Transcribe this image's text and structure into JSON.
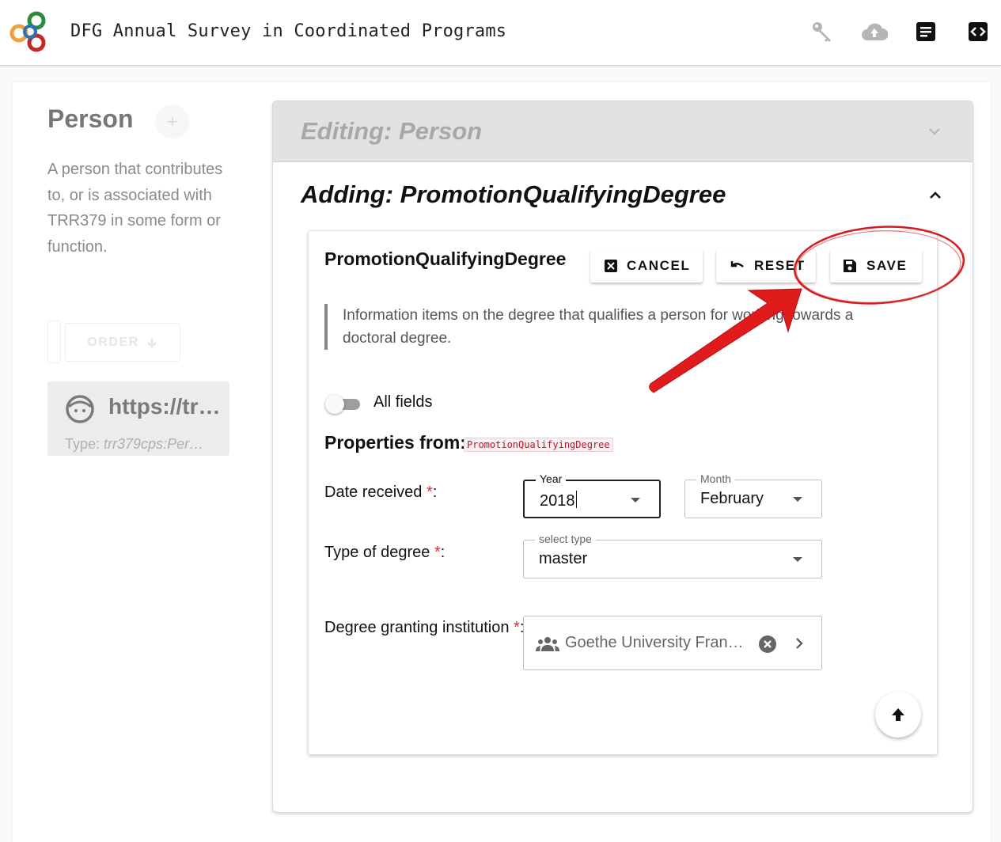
{
  "header": {
    "app_title": "DFG Annual Survey in Coordinated Programs",
    "icons": [
      "key-icon",
      "cloud-upload-icon",
      "document-icon",
      "code-icon"
    ],
    "logo_colors": [
      "#2e8b3c",
      "#f2a13a",
      "#c0282a",
      "#2c6fb7"
    ]
  },
  "sidebar": {
    "title": "Person",
    "add_label": "+",
    "description": "A person that contributes to, or is associated with TRR379 in some form or function.",
    "order_label": "ORDER",
    "item": {
      "title": "https://tr…",
      "type_prefix": "Type: ",
      "type_value": "trr379cps:Per…"
    }
  },
  "editor": {
    "editing_title": "Editing: Person",
    "adding_title": "Adding: PromotionQualifyingDegree"
  },
  "form": {
    "title": "PromotionQualifyingDegree",
    "buttons": {
      "cancel": "CANCEL",
      "reset": "RESET",
      "save": "SAVE"
    },
    "description": "Information items on the degree that qualifies a person for working towards a doctoral degree.",
    "all_fields_label": "All fields",
    "all_fields_on": false,
    "properties_from_label": "Properties from:",
    "properties_from_chip": "PromotionQualifyingDegree",
    "required_marker": "*",
    "date_received": {
      "label": "Date received ",
      "suffix": ":",
      "year_label": "Year",
      "year_value": "2018",
      "month_label": "Month",
      "month_value": "February"
    },
    "type_of_degree": {
      "label": "Type of degree ",
      "suffix": ":",
      "select_label": "select type",
      "value": "master"
    },
    "institution": {
      "label": "Degree granting institution ",
      "suffix": ":",
      "value": "Goethe University Frankf…"
    }
  },
  "colors": {
    "required": "#d32f2f",
    "annotation": "#e01b1b",
    "chip_text": "#c0112a"
  }
}
